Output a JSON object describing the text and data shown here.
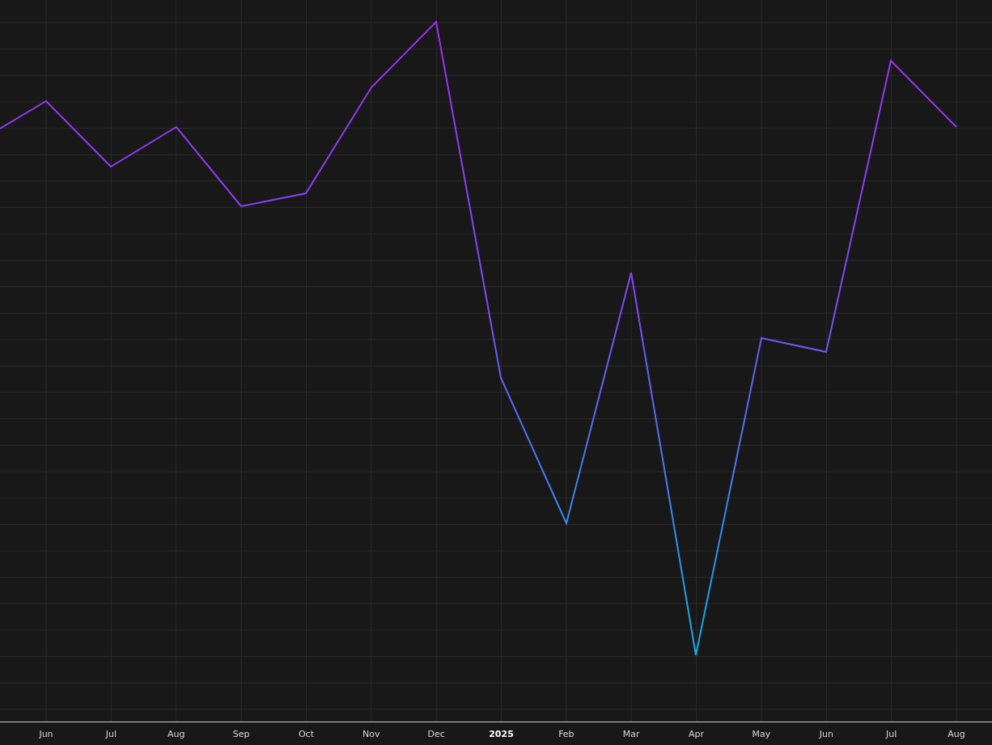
{
  "x_axis": {
    "labels": [
      {
        "text": "Jun",
        "kind": "month"
      },
      {
        "text": "Jul",
        "kind": "month"
      },
      {
        "text": "Aug",
        "kind": "month"
      },
      {
        "text": "Sep",
        "kind": "month"
      },
      {
        "text": "Oct",
        "kind": "month"
      },
      {
        "text": "Nov",
        "kind": "month"
      },
      {
        "text": "Dec",
        "kind": "month"
      },
      {
        "text": "2025",
        "kind": "year"
      },
      {
        "text": "Feb",
        "kind": "month"
      },
      {
        "text": "Mar",
        "kind": "month"
      },
      {
        "text": "Apr",
        "kind": "month"
      },
      {
        "text": "May",
        "kind": "month"
      },
      {
        "text": "Jun",
        "kind": "month"
      },
      {
        "text": "Jul",
        "kind": "month"
      },
      {
        "text": "Aug",
        "kind": "month"
      }
    ]
  }
}
